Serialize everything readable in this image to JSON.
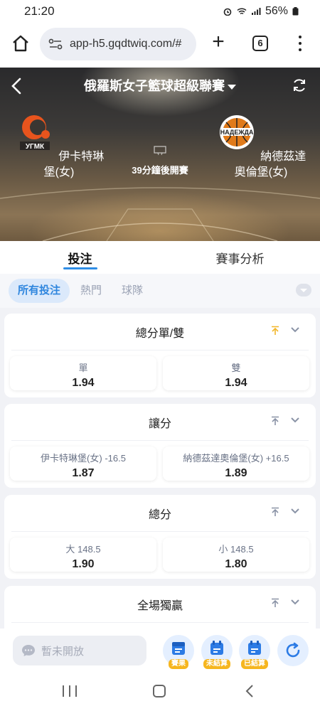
{
  "status": {
    "time": "21:20",
    "battery": "56%"
  },
  "browser": {
    "url": "app-h5.gqdtwiq.com/#",
    "tab_count": "6",
    "new_tab": "+"
  },
  "match": {
    "league": "俄羅斯女子籃球超級聯賽",
    "home_team": "伊卡特琳堡(女)",
    "away_team": "納德茲達奧倫堡(女)",
    "start_number": "39",
    "start_text": "分鐘後開賽"
  },
  "tabs": [
    {
      "label": "投注"
    },
    {
      "label": "賽事分析"
    }
  ],
  "filters": [
    {
      "label": "所有投注"
    },
    {
      "label": "熱門"
    },
    {
      "label": "球隊"
    }
  ],
  "markets": [
    {
      "title": "總分單/雙",
      "pin_color": "#f2b62a",
      "left": {
        "label": "單",
        "odds": "1.94"
      },
      "right": {
        "label": "雙",
        "odds": "1.94"
      }
    },
    {
      "title": "讓分",
      "pin_color": "#8a93a6",
      "left": {
        "label": "伊卡特琳堡(女) -16.5",
        "odds": "1.87"
      },
      "right": {
        "label": "納德茲達奧倫堡(女) +16.5",
        "odds": "1.89"
      }
    },
    {
      "title": "總分",
      "pin_color": "#8a93a6",
      "left": {
        "label": "大 148.5",
        "odds": "1.90"
      },
      "right": {
        "label": "小 148.5",
        "odds": "1.80"
      }
    },
    {
      "title": "全場獨贏",
      "pin_color": "#8a93a6"
    }
  ],
  "bottom": {
    "chat_placeholder": "暫未開放",
    "actions": [
      {
        "label": "賽果"
      },
      {
        "label": "未結算"
      },
      {
        "label": "已結算"
      }
    ]
  },
  "colors": {
    "accent": "#2f8ee6",
    "badge": "#f6b61f"
  }
}
